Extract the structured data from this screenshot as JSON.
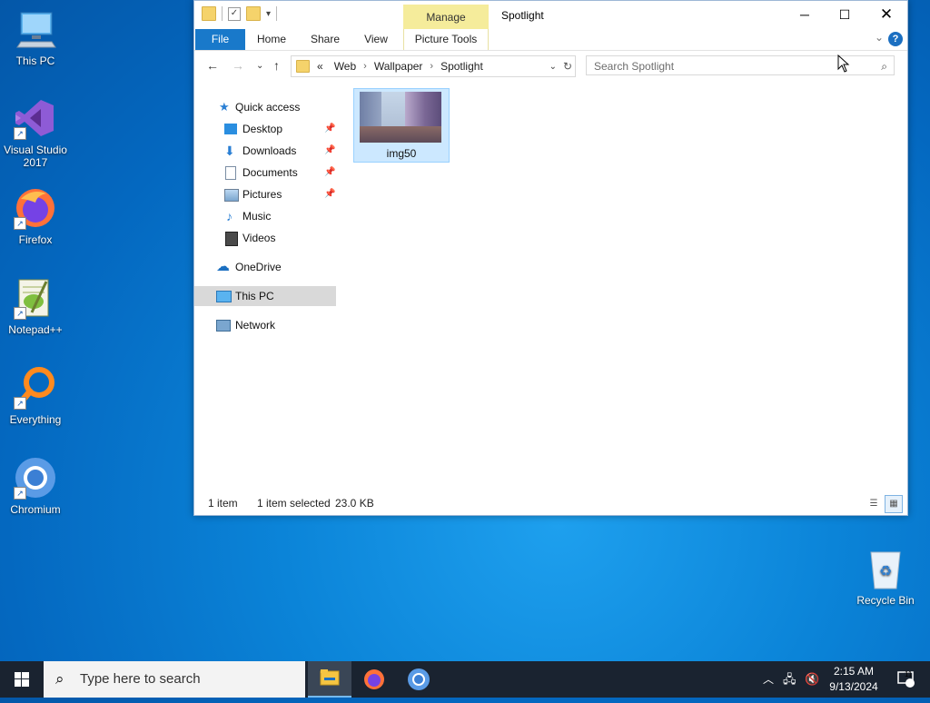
{
  "desktop": {
    "icons": [
      {
        "label": "This PC"
      },
      {
        "label": "Visual Studio 2017"
      },
      {
        "label": "Firefox"
      },
      {
        "label": "Notepad++"
      },
      {
        "label": "Everything"
      },
      {
        "label": "Chromium"
      },
      {
        "label": "Recycle Bin"
      }
    ]
  },
  "window": {
    "title": "Spotlight",
    "contextual_tab_group": "Manage",
    "ribbon_tabs": [
      "File",
      "Home",
      "Share",
      "View",
      "Picture Tools"
    ],
    "address": {
      "overflow": "«",
      "crumbs": [
        "Web",
        "Wallpaper",
        "Spotlight"
      ]
    },
    "search_placeholder": "Search Spotlight",
    "nav_pane": {
      "quick_access": "Quick access",
      "pinned": [
        "Desktop",
        "Downloads",
        "Documents",
        "Pictures"
      ],
      "unpinned": [
        "Music",
        "Videos"
      ],
      "onedrive": "OneDrive",
      "this_pc": "This PC",
      "network": "Network"
    },
    "files": [
      {
        "name": "img50",
        "selected": true
      }
    ],
    "status": {
      "count": "1 item",
      "selection": "1 item selected",
      "size": "23.0 KB"
    }
  },
  "taskbar": {
    "search_placeholder": "Type here to search",
    "time": "2:15 AM",
    "date": "9/13/2024",
    "notification_count": "11"
  },
  "colors": {
    "ribbon_file_tab": "#1979ca",
    "manage_tab": "#f5ec9b",
    "selection": "#cce8ff",
    "taskbar": "#1a2330"
  }
}
